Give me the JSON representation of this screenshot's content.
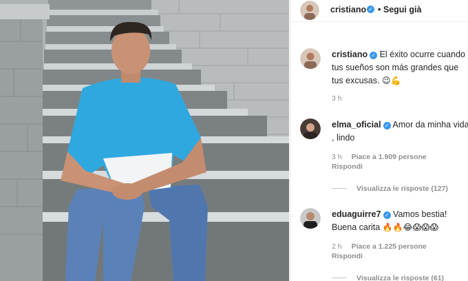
{
  "post_header": {
    "username": "cristiano",
    "separator": "•",
    "follow_label": "Segui già"
  },
  "caption": {
    "username": "cristiano",
    "text": "El éxito ocurre cuando tus sueños son más grandes que tus excusas.",
    "emojis": "😉💪",
    "time": "3 h"
  },
  "comments": [
    {
      "username": "elma_oficial",
      "text": "Amor da minha vida , lindo",
      "time": "3 h",
      "likes": "Piace a 1.909 persone",
      "reply_label": "Rispondi",
      "view_replies": "Visualizza le risposte (127)"
    },
    {
      "username": "eduaguirre7",
      "text": "Vamos bestia! Buena carita",
      "emojis": "🔥🔥😂😱😱😱",
      "time": "2 h",
      "likes": "Piace a 1.225 persone",
      "reply_label": "Rispondi",
      "view_replies": "Visualizza le risposte (61)"
    }
  ],
  "colors": {
    "verified": "#3897f0",
    "shirt_blue": "#2fa8e0",
    "jeans": "#5a82b8"
  },
  "icons": {
    "verified": "verified-badge-icon"
  }
}
